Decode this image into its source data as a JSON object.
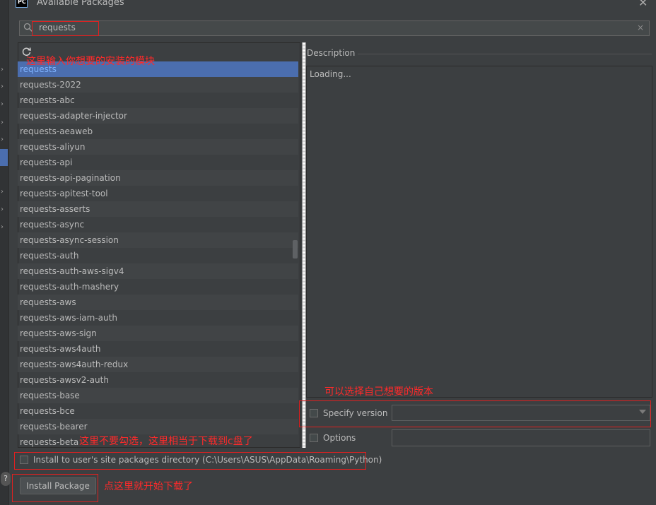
{
  "window": {
    "title": "Available Packages",
    "app_icon": "PC"
  },
  "search": {
    "value": "requests",
    "clear": "×"
  },
  "packages": [
    "requests",
    "requests-2022",
    "requests-abc",
    "requests-adapter-injector",
    "requests-aeaweb",
    "requests-aliyun",
    "requests-api",
    "requests-api-pagination",
    "requests-apitest-tool",
    "requests-asserts",
    "requests-async",
    "requests-async-session",
    "requests-auth",
    "requests-auth-aws-sigv4",
    "requests-auth-mashery",
    "requests-aws",
    "requests-aws-iam-auth",
    "requests-aws-sign",
    "requests-aws4auth",
    "requests-aws4auth-redux",
    "requests-awsv2-auth",
    "requests-base",
    "requests-bce",
    "requests-bearer",
    "requests-beta"
  ],
  "selected_index": 0,
  "description": {
    "label": "Description",
    "text": "Loading..."
  },
  "specify_version": {
    "label": "Specify version",
    "checked": false,
    "value": ""
  },
  "options": {
    "label": "Options",
    "checked": false,
    "value": ""
  },
  "install_user": {
    "label": "Install to user's site packages directory (C:\\Users\\ASUS\\AppData\\Roaming\\Python)",
    "checked": false
  },
  "install_button": {
    "label": "Install Package"
  },
  "annotations": {
    "search_note": "这里输入你想要的安装的模块",
    "version_note": "可以选择自己想要的版本",
    "user_dir_note": "这里不要勾选，这里相当于下载到c盘了",
    "install_note": "点这里就开始下载了"
  },
  "colors": {
    "annotation": "#ff2a2a",
    "selection": "#4b6eaf",
    "background": "#3c3f41"
  }
}
